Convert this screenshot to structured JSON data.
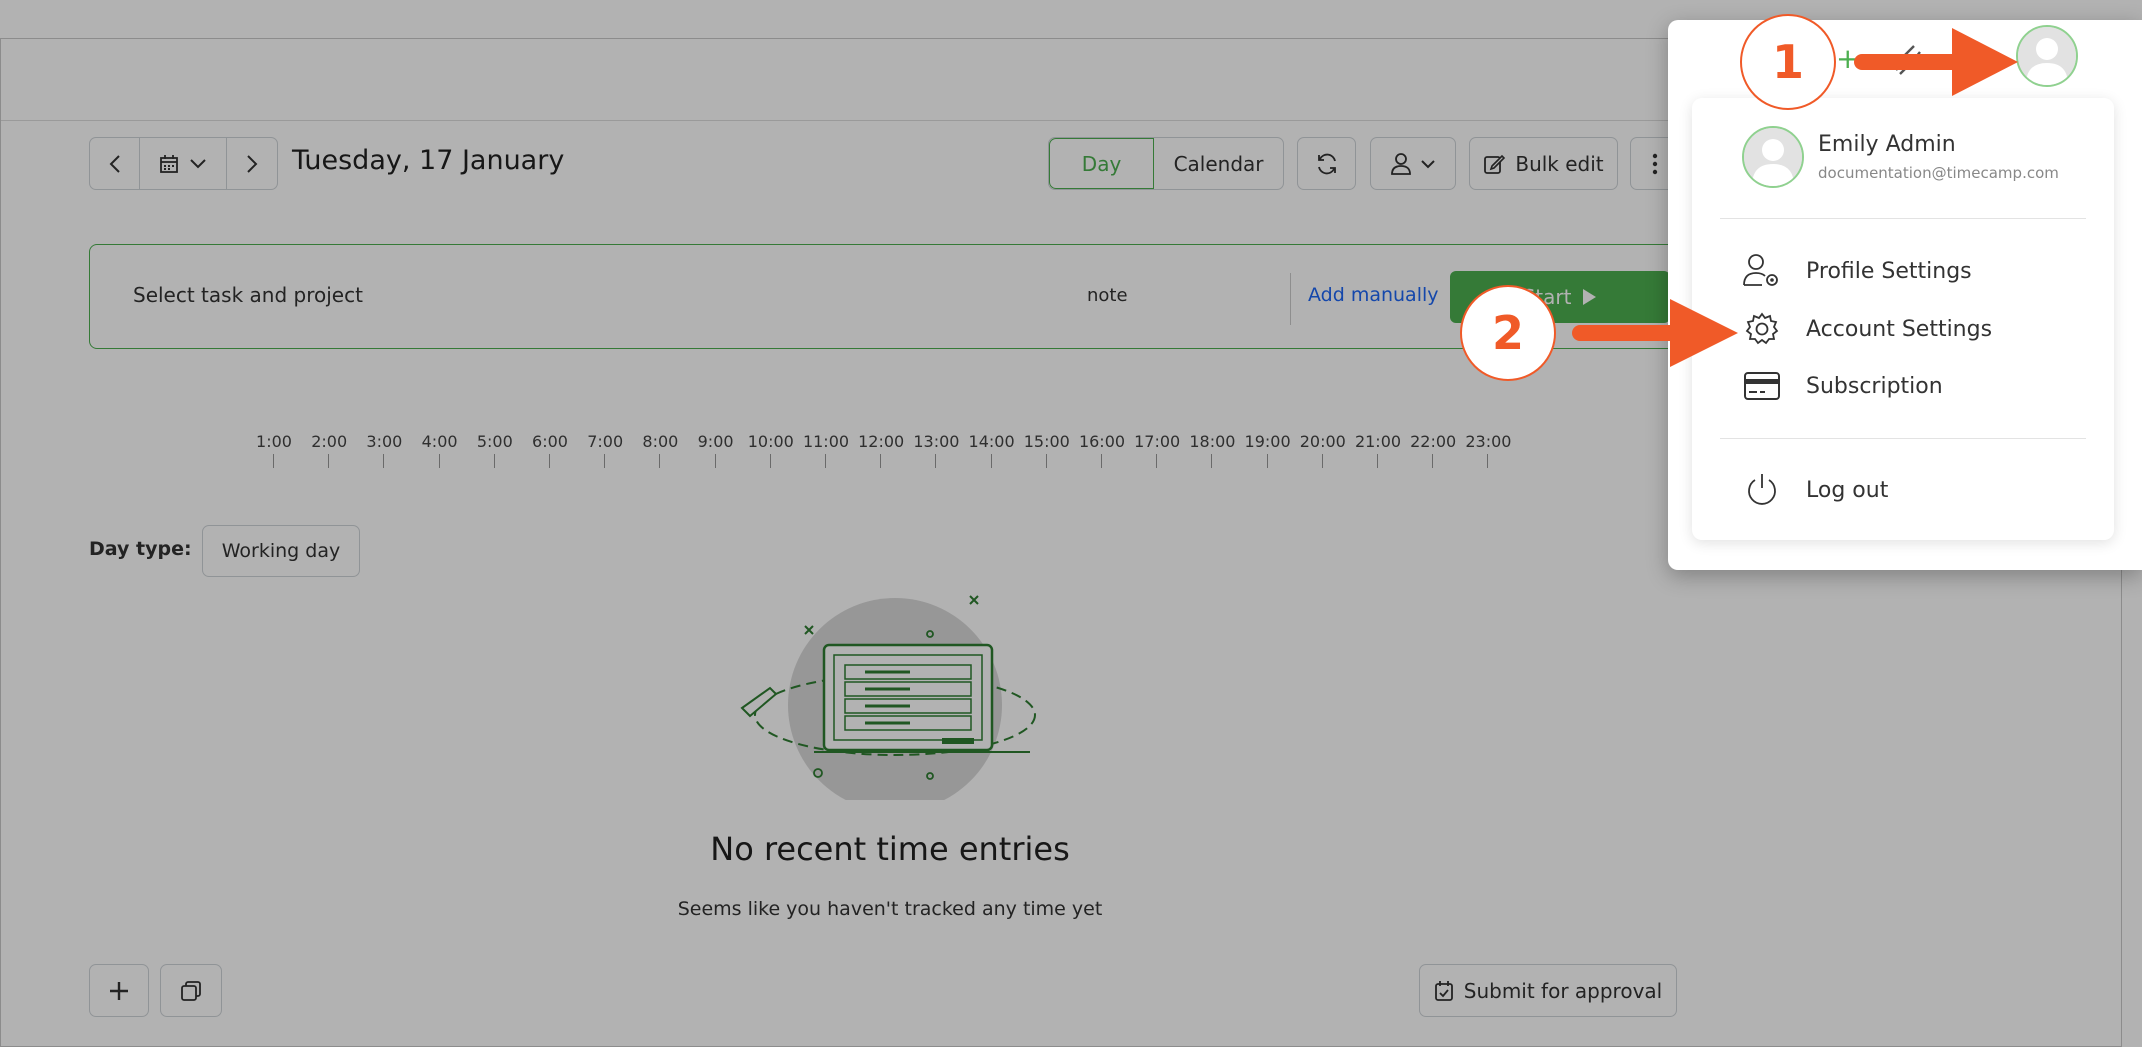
{
  "colors": {
    "accent_green": "#4caf50",
    "link_blue": "#1e66f5",
    "callout_orange": "#f05a28"
  },
  "header": {
    "date_title": "Tuesday, 17 January",
    "view_day": "Day",
    "view_calendar": "Calendar",
    "bulk_edit": "Bulk edit"
  },
  "tracker": {
    "task_placeholder": "Select task and project",
    "note_placeholder": "note",
    "add_manually": "Add manually",
    "start_label": "Start"
  },
  "timeline": {
    "hours": [
      "1:00",
      "2:00",
      "3:00",
      "4:00",
      "5:00",
      "6:00",
      "7:00",
      "8:00",
      "9:00",
      "10:00",
      "11:00",
      "12:00",
      "13:00",
      "14:00",
      "15:00",
      "16:00",
      "17:00",
      "18:00",
      "19:00",
      "20:00",
      "21:00",
      "22:00",
      "23:00"
    ]
  },
  "day_type": {
    "label": "Day type:",
    "value": "Working day"
  },
  "empty_state": {
    "title": "No recent time entries",
    "subtitle": "Seems like you haven't tracked any time yet"
  },
  "footer": {
    "submit_label": "Submit for approval"
  },
  "account_menu": {
    "user_name": "Emily Admin",
    "user_email": "documentation@timecamp.com",
    "items": [
      {
        "label": "Profile Settings",
        "icon": "user-gear-icon"
      },
      {
        "label": "Account Settings",
        "icon": "gear-icon"
      },
      {
        "label": "Subscription",
        "icon": "credit-card-icon"
      },
      {
        "label": "Log out",
        "icon": "power-icon"
      }
    ]
  },
  "callouts": [
    "1",
    "2"
  ]
}
